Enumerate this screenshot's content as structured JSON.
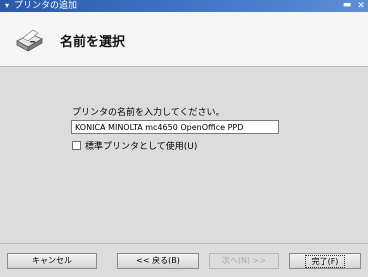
{
  "window": {
    "title": "プリンタの追加",
    "menu_glyph": "▾",
    "minimize_glyph": "▬",
    "close_glyph": "✕"
  },
  "header": {
    "heading": "名前を選択",
    "icon": "printer-icon"
  },
  "form": {
    "prompt": "プリンタの名前を入力してください。",
    "printer_name": "KONICA MINOLTA mc4650 OpenOffice PPD",
    "default_label": "標準プリンタとして使用(U)",
    "default_checked": false
  },
  "buttons": {
    "cancel": "キャンセル",
    "back": "<< 戻る(B)",
    "next": "次へ(N) >>",
    "finish": "完了(F)"
  },
  "colors": {
    "titlebar": "#3d71c4",
    "header_bg": "#f5f5f5",
    "body_bg": "#dcdcdc"
  }
}
